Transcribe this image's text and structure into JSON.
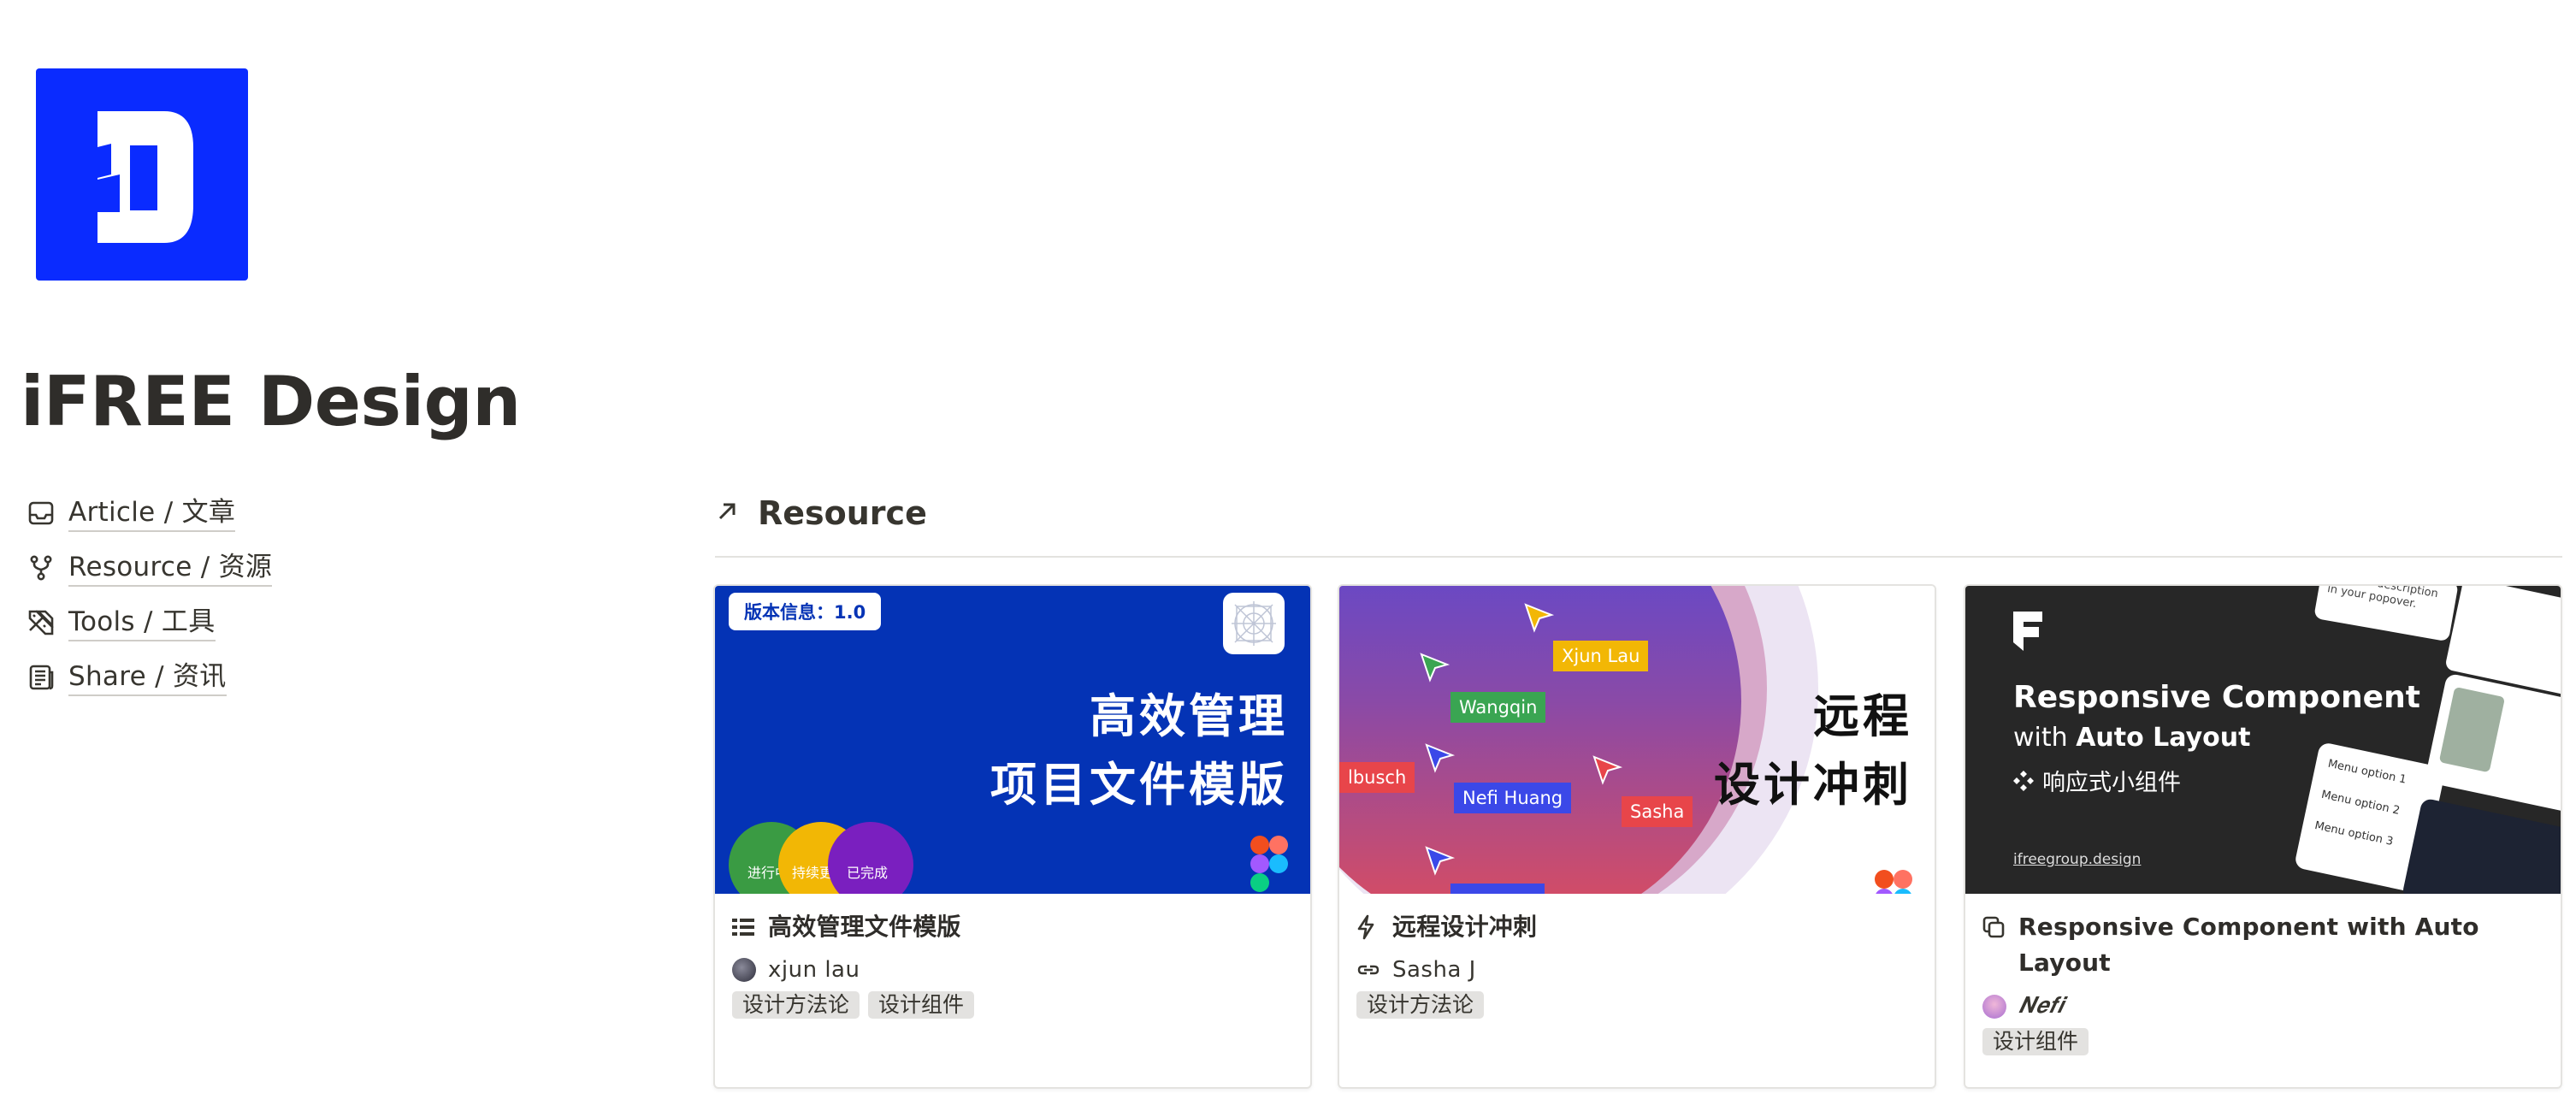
{
  "page": {
    "title": "iFREE Design"
  },
  "nav": [
    {
      "label": "Article / 文章",
      "icon": "inbox-icon"
    },
    {
      "label": "Resource / 资源",
      "icon": "git-branch-icon"
    },
    {
      "label": "Tools / 工具",
      "icon": "tools-icon"
    },
    {
      "label": "Share / 资讯",
      "icon": "newspaper-icon"
    }
  ],
  "section": {
    "title": "Resource",
    "icon": "arrow-up-right-icon"
  },
  "cards": [
    {
      "title": "高效管理文件模版",
      "title_icon": "list-icon",
      "author": "xjun lau",
      "tags": [
        "设计方法论",
        "设计组件"
      ],
      "cover": {
        "version_badge": "版本信息：1.0",
        "heading_line1": "高效管理",
        "heading_line2": "项目文件模版",
        "circles": [
          "进行中",
          "持续更",
          "已完成"
        ],
        "bg_color": "#0433b5"
      }
    },
    {
      "title": "远程设计冲刺",
      "title_icon": "lightning-icon",
      "author": "Sasha J",
      "tags": [
        "设计方法论"
      ],
      "cover": {
        "names": [
          "Xjun Lau",
          "Wangqin",
          "lbusch",
          "Nefi Huang",
          "Sasha"
        ],
        "heading_line1": "远程",
        "heading_line2": "设计冲刺"
      }
    },
    {
      "title": "Responsive Component with Auto Layout",
      "title_icon": "copy-icon",
      "author": "𝑵𝒆𝒇𝒊",
      "tags": [
        "设计组件"
      ],
      "cover": {
        "heading": "Responsive Component",
        "subheading_prefix": "with ",
        "subheading_bold": "Auto Layout",
        "chinese": "响应式小组件",
        "url": "ifreegroup.design",
        "popover_text": "This the description in your popover.",
        "menu_options": [
          "Menu option 1",
          "Menu option 2",
          "Menu option 3"
        ],
        "bg_color": "#272727"
      }
    }
  ]
}
